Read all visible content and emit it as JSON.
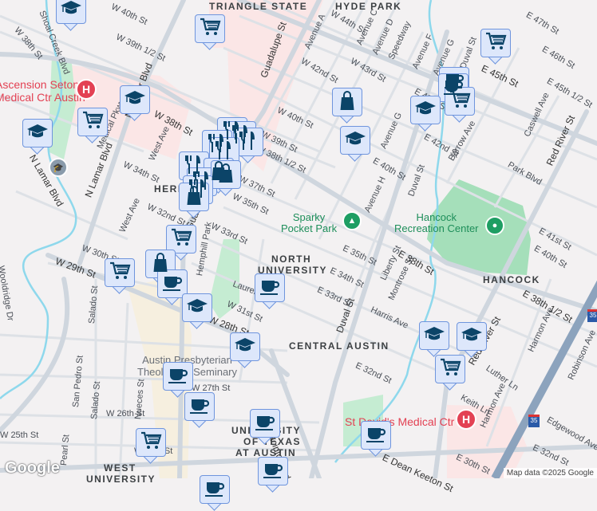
{
  "map": {
    "labels": {
      "w40th": "W 40th St",
      "w38th_l": "W 38th St",
      "w39half": "W 39th 1/2 St",
      "shoal": "Shoal Creek Blvd",
      "w38th": "W 38th St",
      "lamar1": "N Lamar Blvd",
      "lamar2": "N Lamar Blvd",
      "lamar3": "N Lamar Blvd",
      "medical": "Medical Pkwy",
      "westave": "West Ave",
      "westave2": "West Ave",
      "w34th": "W 34th St",
      "w32nd": "W 32nd St",
      "w33rd": "W 33rd St",
      "w35th": "W 35th St",
      "w37th": "W 37th St",
      "w39th": "W 39th St",
      "w38half": "W 38th 1/2 St",
      "w40th2": "W 40th St",
      "guadalupe": "Guadalupe St",
      "guadalupe2": "Guadalupe St",
      "w44th": "W 44th St",
      "aveA": "Avenue A",
      "aveC": "Avenue C",
      "aveD": "Avenue D",
      "speedway": "Speedway",
      "aveF": "Avenue F",
      "aveG": "Avenue G",
      "aveG2": "Avenue G",
      "aveH": "Avenue H",
      "w42nd": "W 42nd St",
      "w43rd": "W 43rd St",
      "e43rd": "E 43rd St",
      "e42nd": "E 42nd St",
      "e40th": "E 40th St",
      "duval": "Duval St",
      "duval2": "Duval St",
      "duval3": "Duval St",
      "barrow": "Barrow Ave",
      "parkblvd": "Park Blvd",
      "caswell": "Caswell Ave",
      "redriver": "Red River St",
      "redriver2": "Red River St",
      "e47th": "E 47th St",
      "e46th": "E 46th St",
      "e45th": "E 45th St",
      "e45half": "E 45th 1/2 St",
      "e41st": "E 41st St",
      "e40th2": "E 40th St",
      "e38th": "E 38th St",
      "e38half": "E 38th 1/2 St",
      "e35th": "E 35th St",
      "e34th": "E 34th St",
      "e33rd": "E 33rd St",
      "liberty": "Liberty St",
      "montrose": "Montrose St",
      "harris": "Harris Ave",
      "harmon": "Harmon Ave",
      "harmon2": "Harmon Ave",
      "luther": "Luther Ln",
      "keith": "Keith Ln",
      "robinson": "Robinson Ave",
      "e32nd": "E 32nd St",
      "e32nd2": "E 32nd St",
      "e30th": "E 30th St",
      "edgewood": "Edgewood Ave",
      "deankeeton": "E Dean Keeton St",
      "sanjacinto": "San Jacinto Blvd",
      "w30th": "W 30th St",
      "w29th": "W 29th St",
      "w31st": "W 31st St",
      "laurel": "Laurel Ln",
      "hemphill": "Hemphill Park",
      "w27th": "W 27th St",
      "w26th": "W 26th St",
      "w25th": "W 25th St",
      "wooldridge": "Wooldridge Dr",
      "sanpedro": "San Pedro St",
      "salado": "Salado St",
      "salado2": "Salado St",
      "nueces": "Nueces St",
      "pearl": "Pearl St",
      "w24th": "W 24th St",
      "w28th": "W 28th St"
    },
    "neighborhoods": {
      "hyde_park": "HYDE PARK",
      "triangle": "TRIANGLE STATE",
      "heritage": "HERITAGE",
      "north_univ1": "NORTH",
      "north_univ2": "UNIVERSITY",
      "central": "CENTRAL AUSTIN",
      "hancock": "HANCOCK",
      "ut1": "UNIVERSITY",
      "ut2": "OF TEXAS",
      "ut3": "AT AUSTIN",
      "west_univ1": "WEST",
      "west_univ2": "UNIVERSITY"
    },
    "pois": {
      "seton1": "Ascension Seton",
      "seton2": "Medical Ctr Austin",
      "sparky1": "Sparky",
      "sparky2": "Pocket Park",
      "hancock1": "Hancock",
      "hancock2": "Recreation Center",
      "presby1": "Austin Presbyterian",
      "presby2": "Theological Seminary",
      "stdavids": "St David's Medical Ctr"
    },
    "hospital_glyph": "H",
    "interstate": "35",
    "logo": "Google",
    "attribution": "Map data ©2025 Google"
  },
  "markers": [
    {
      "type": "school"
    },
    {
      "type": "grocery"
    },
    {
      "type": "school"
    },
    {
      "type": "grocery"
    },
    {
      "type": "school"
    },
    {
      "type": "restaurant"
    },
    {
      "type": "restaurant"
    },
    {
      "type": "restaurant"
    },
    {
      "type": "restaurant"
    },
    {
      "type": "restaurant"
    },
    {
      "type": "restaurant"
    },
    {
      "type": "shopping"
    },
    {
      "type": "restaurant"
    },
    {
      "type": "shopping"
    },
    {
      "type": "restaurant"
    },
    {
      "type": "shopping"
    },
    {
      "type": "shopping"
    },
    {
      "type": "school"
    },
    {
      "type": "grocery"
    },
    {
      "type": "cafe"
    },
    {
      "type": "cafe"
    },
    {
      "type": "grocery"
    },
    {
      "type": "school"
    },
    {
      "type": "grocery"
    },
    {
      "type": "shopping"
    },
    {
      "type": "grocery"
    },
    {
      "type": "cafe"
    },
    {
      "type": "school"
    },
    {
      "type": "cafe"
    },
    {
      "type": "school"
    },
    {
      "type": "cafe"
    },
    {
      "type": "cafe"
    },
    {
      "type": "cafe"
    },
    {
      "type": "grocery"
    },
    {
      "type": "cafe"
    },
    {
      "type": "school"
    },
    {
      "type": "school"
    },
    {
      "type": "grocery"
    },
    {
      "type": "cafe"
    },
    {
      "type": "cafe"
    }
  ],
  "colors": {
    "marker_fill": "#dde7fb",
    "marker_border": "#6f95dd",
    "icon": "#0b4468",
    "park": "#a8e2bd",
    "hospital_area": "#fbe3e3",
    "interstate": "#8ca3bd"
  }
}
